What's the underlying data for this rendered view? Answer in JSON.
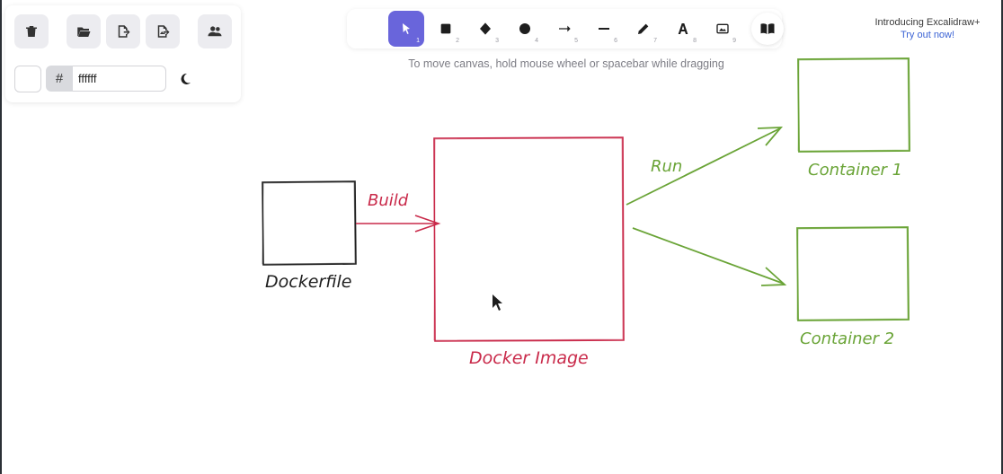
{
  "left_panel": {
    "buttons": [
      {
        "name": "delete-button",
        "icon": "trash-icon"
      },
      {
        "name": "open-button",
        "icon": "folder-open-icon"
      },
      {
        "name": "export-button",
        "icon": "export-file-icon"
      },
      {
        "name": "save-as-image-button",
        "icon": "export-image-icon"
      },
      {
        "name": "collaborate-button",
        "icon": "users-icon"
      }
    ],
    "background_color": {
      "hash": "#",
      "value": "ffffff"
    },
    "theme_toggle_icon": "moon-icon"
  },
  "toolbar": {
    "lock_icon": "unlock-icon",
    "tools": [
      {
        "name": "selection",
        "icon": "pointer-icon",
        "shortcut": "1",
        "active": true
      },
      {
        "name": "rectangle",
        "icon": "square-icon",
        "shortcut": "2"
      },
      {
        "name": "diamond",
        "icon": "diamond-icon",
        "shortcut": "3"
      },
      {
        "name": "ellipse",
        "icon": "circle-icon",
        "shortcut": "4"
      },
      {
        "name": "arrow",
        "icon": "arrow-icon",
        "shortcut": "5"
      },
      {
        "name": "line",
        "icon": "line-icon",
        "shortcut": "6"
      },
      {
        "name": "draw",
        "icon": "pencil-icon",
        "shortcut": "7"
      },
      {
        "name": "text",
        "icon": "text-icon",
        "shortcut": "8"
      },
      {
        "name": "image",
        "icon": "image-icon",
        "shortcut": "9"
      }
    ],
    "library_icon": "book-icon",
    "hint": "To move canvas, hold mouse wheel or spacebar while dragging"
  },
  "promo": {
    "title": "Introducing Excalidraw+",
    "link": "Try out now!"
  },
  "diagram": {
    "dockerfile_label": "Dockerfile",
    "build_label": "Build",
    "image_label": "Docker Image",
    "run_label": "Run",
    "container1_label": "Container 1",
    "container2_label": "Container 2",
    "colors": {
      "black": "#1e1e1e",
      "red": "#c92a4a",
      "green": "#6aa437",
      "accent": "#6965db"
    }
  }
}
